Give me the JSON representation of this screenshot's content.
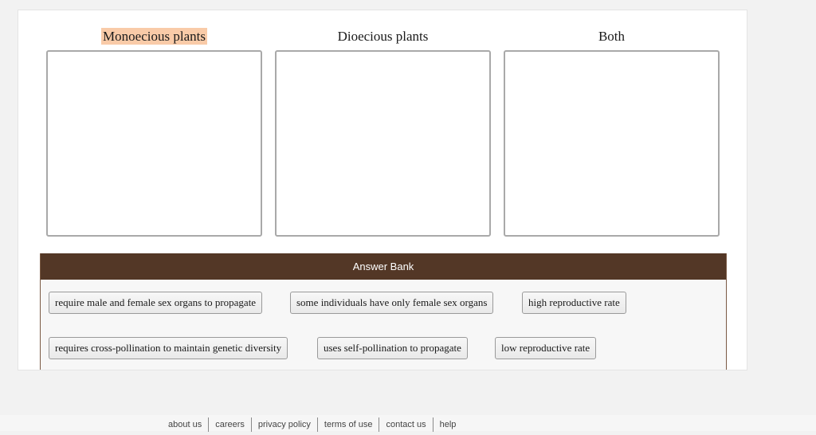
{
  "columns": [
    {
      "title": "Monoecious plants",
      "highlighted": true
    },
    {
      "title": "Dioecious plants",
      "highlighted": false
    },
    {
      "title": "Both",
      "highlighted": false
    }
  ],
  "answer_bank": {
    "title": "Answer Bank",
    "items": [
      "require male and female sex organs to propagate",
      "some individuals have only female sex organs",
      "high reproductive rate",
      "requires cross-pollination to maintain genetic diversity",
      "uses self-pollination to propagate",
      "low reproductive rate"
    ]
  },
  "footer": {
    "links": [
      "about us",
      "careers",
      "privacy policy",
      "terms of use",
      "contact us",
      "help"
    ]
  },
  "colors": {
    "highlight": "#f9cba8",
    "bank_header": "#533726"
  }
}
